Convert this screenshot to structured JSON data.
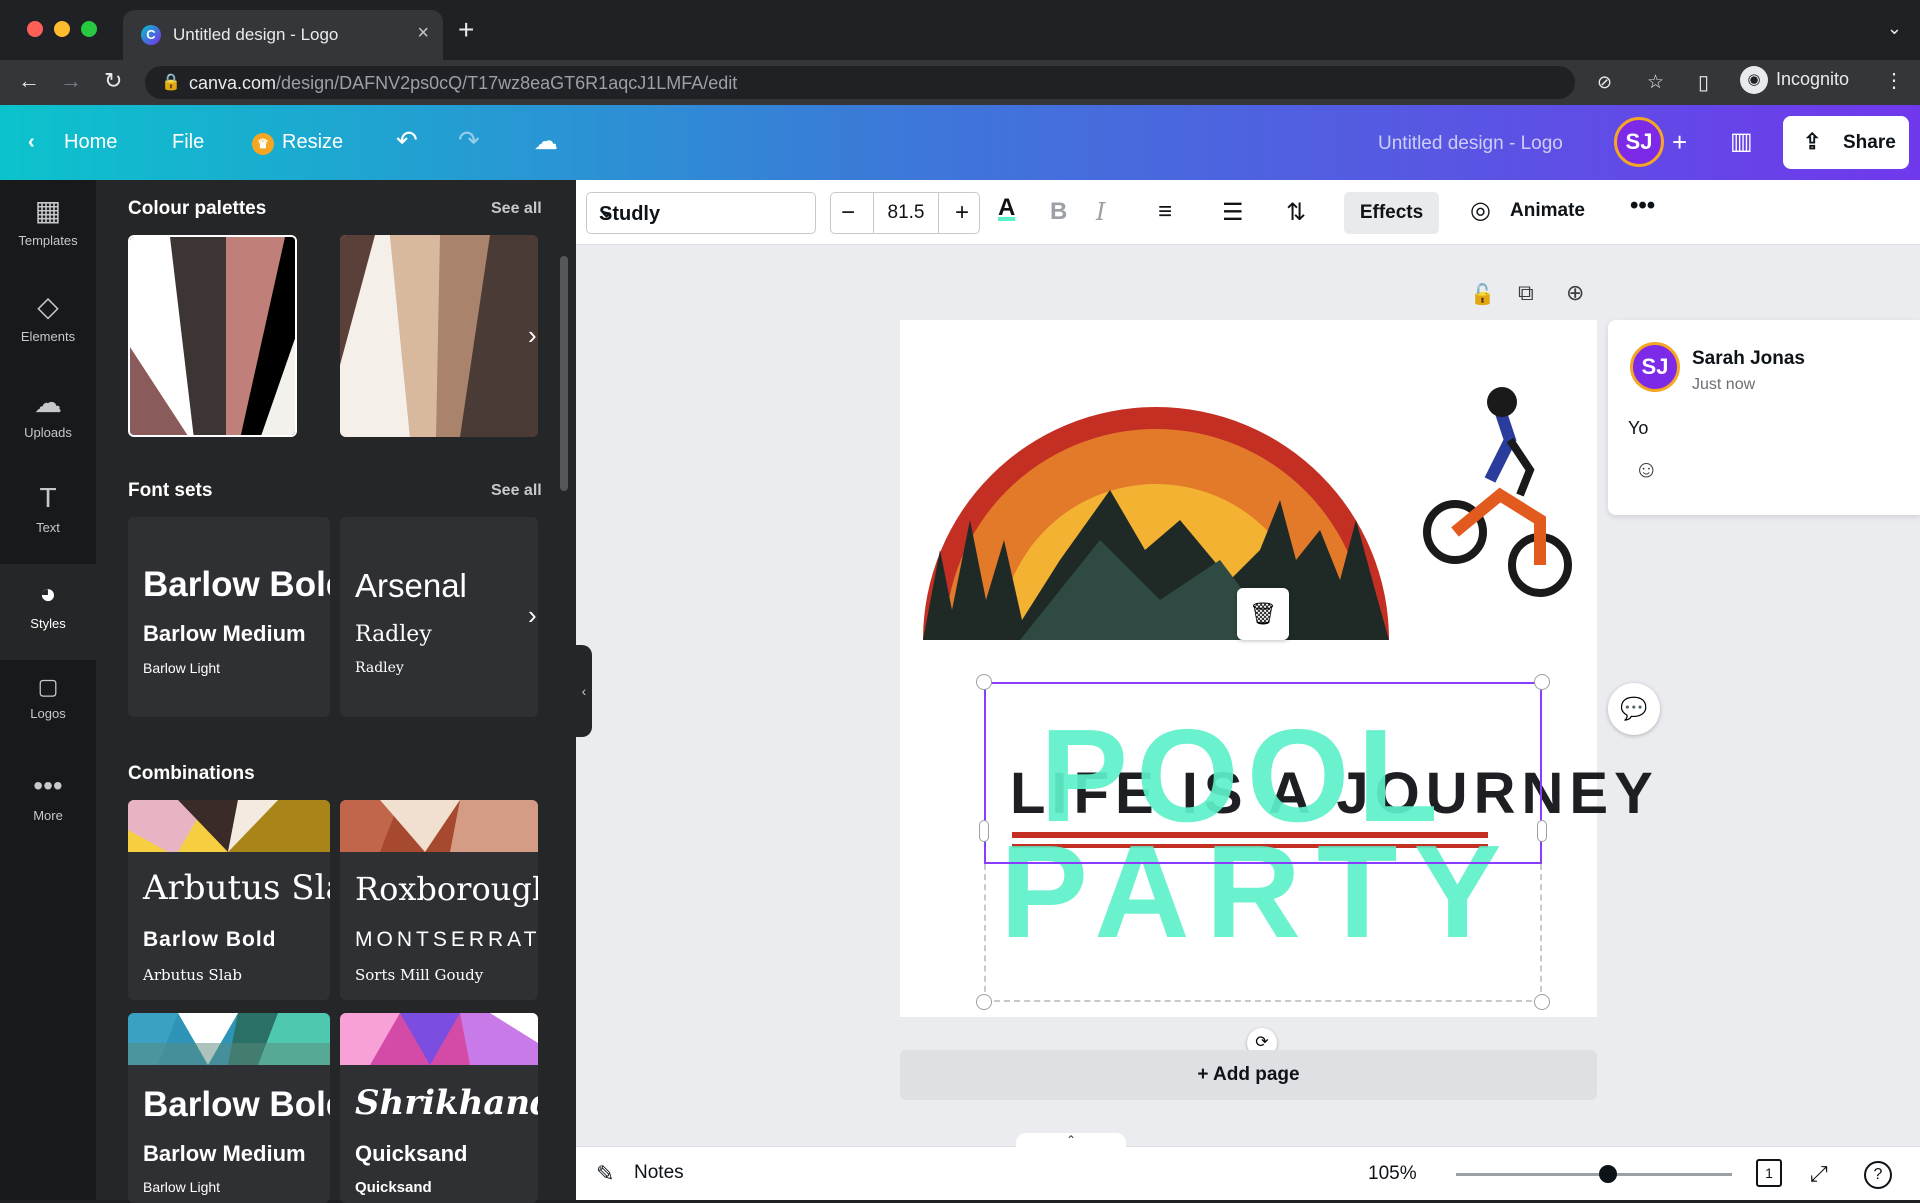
{
  "browser": {
    "tab_title": "Untitled design - Logo",
    "url_host": "canva.com",
    "url_path": "/design/DAFNV2ps0cQ/T17wz8eaGT6R1aqcJ1LMFA/edit",
    "profile": "Incognito"
  },
  "header": {
    "home": "Home",
    "file": "File",
    "resize": "Resize",
    "doc_title": "Untitled design - Logo",
    "avatar": "SJ",
    "share": "Share"
  },
  "rail": {
    "items": [
      {
        "label": "Templates",
        "icon": "templates-icon"
      },
      {
        "label": "Elements",
        "icon": "elements-icon"
      },
      {
        "label": "Uploads",
        "icon": "uploads-icon"
      },
      {
        "label": "Text",
        "icon": "text-icon"
      },
      {
        "label": "Styles",
        "icon": "styles-icon"
      },
      {
        "label": "Logos",
        "icon": "logos-icon"
      },
      {
        "label": "More",
        "icon": "more-icon"
      }
    ]
  },
  "panel": {
    "palettes_title": "Colour palettes",
    "fontsets_title": "Font sets",
    "combos_title": "Combinations",
    "see_all": "See all",
    "font_sets": [
      {
        "l1": "Barlow Bold",
        "l2": "Barlow Medium",
        "l3": "Barlow Light"
      },
      {
        "l1": "Arsenal",
        "l2": "Radley",
        "l3": "Radley"
      }
    ],
    "combinations": [
      {
        "l1": "Arbutus Slab",
        "l2": "Barlow Bold",
        "l3": "Arbutus Slab"
      },
      {
        "l1": "Roxborough",
        "l2": "MONTSERRAT",
        "l3": "Sorts Mill Goudy"
      },
      {
        "l1": "Barlow Bold",
        "l2": "Barlow Medium",
        "l3": "Barlow Light"
      },
      {
        "l1": "Shrikhand",
        "l2": "Quicksand",
        "l3": "Quicksand"
      }
    ]
  },
  "toolbar": {
    "font": "Studly",
    "font_size": "81.5",
    "effects": "Effects",
    "animate": "Animate"
  },
  "canvas": {
    "text_back": "LIFE IS A JOURNEY",
    "text_line1": "POOL",
    "text_line2": "PARTY",
    "add_page": "+ Add page"
  },
  "comment": {
    "avatar": "SJ",
    "name": "Sarah Jonas",
    "time": "Just now",
    "text": "Yo"
  },
  "bottom": {
    "notes": "Notes",
    "zoom": "105%",
    "zoom_level": 0.55,
    "page_count": "1"
  },
  "colors": {
    "accent_text": "#5ef0c9",
    "selection": "#8b3dff"
  }
}
